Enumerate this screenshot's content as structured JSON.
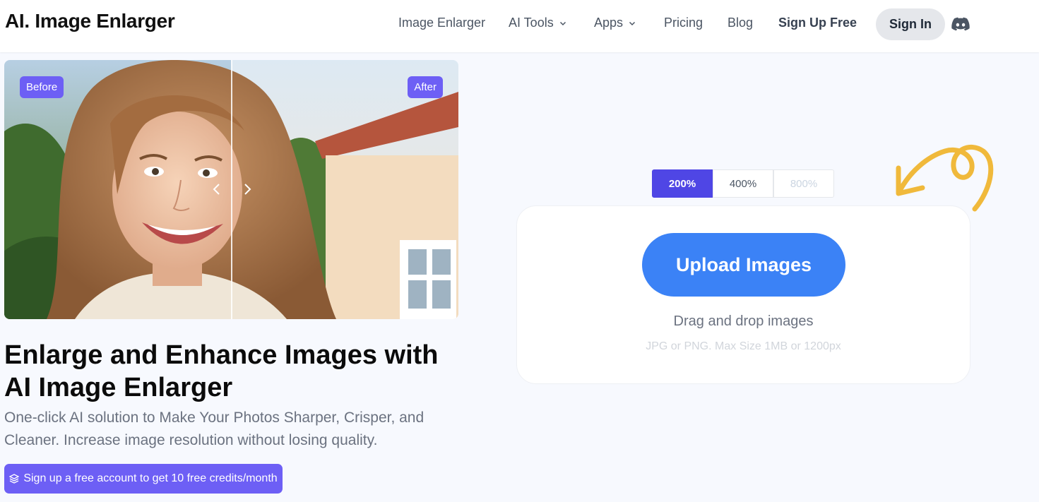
{
  "header": {
    "logo": "AI. Image Enlarger",
    "nav": [
      {
        "label": "Image Enlarger",
        "has_dropdown": false
      },
      {
        "label": "AI Tools",
        "has_dropdown": true
      },
      {
        "label": "Apps",
        "has_dropdown": true
      },
      {
        "label": "Pricing",
        "has_dropdown": false
      },
      {
        "label": "Blog",
        "has_dropdown": false
      }
    ],
    "signup_label": "Sign Up Free",
    "signin_label": "Sign In",
    "discord_icon": "discord-icon"
  },
  "compare": {
    "before_label": "Before",
    "after_label": "After"
  },
  "hero": {
    "title": "Enlarge and Enhance Images with AI Image Enlarger",
    "subtitle": "One-click AI solution to Make Your Photos Sharper, Crisper, and Cleaner. Increase image resolution without losing quality.",
    "credits_button": "Sign up a free account to get 10 free credits/month"
  },
  "scales": [
    {
      "label": "200%",
      "state": "active"
    },
    {
      "label": "400%",
      "state": "normal"
    },
    {
      "label": "800%",
      "state": "disabled"
    }
  ],
  "upload": {
    "button_label": "Upload Images",
    "drag_text": "Drag and drop images",
    "hint_text": "JPG or PNG. Max Size 1MB or 1200px"
  },
  "colors": {
    "accent_purple": "#6d5ff5",
    "scale_active": "#4f46e5",
    "upload_blue": "#3b82f6",
    "doodle_yellow": "#f0b93b"
  }
}
